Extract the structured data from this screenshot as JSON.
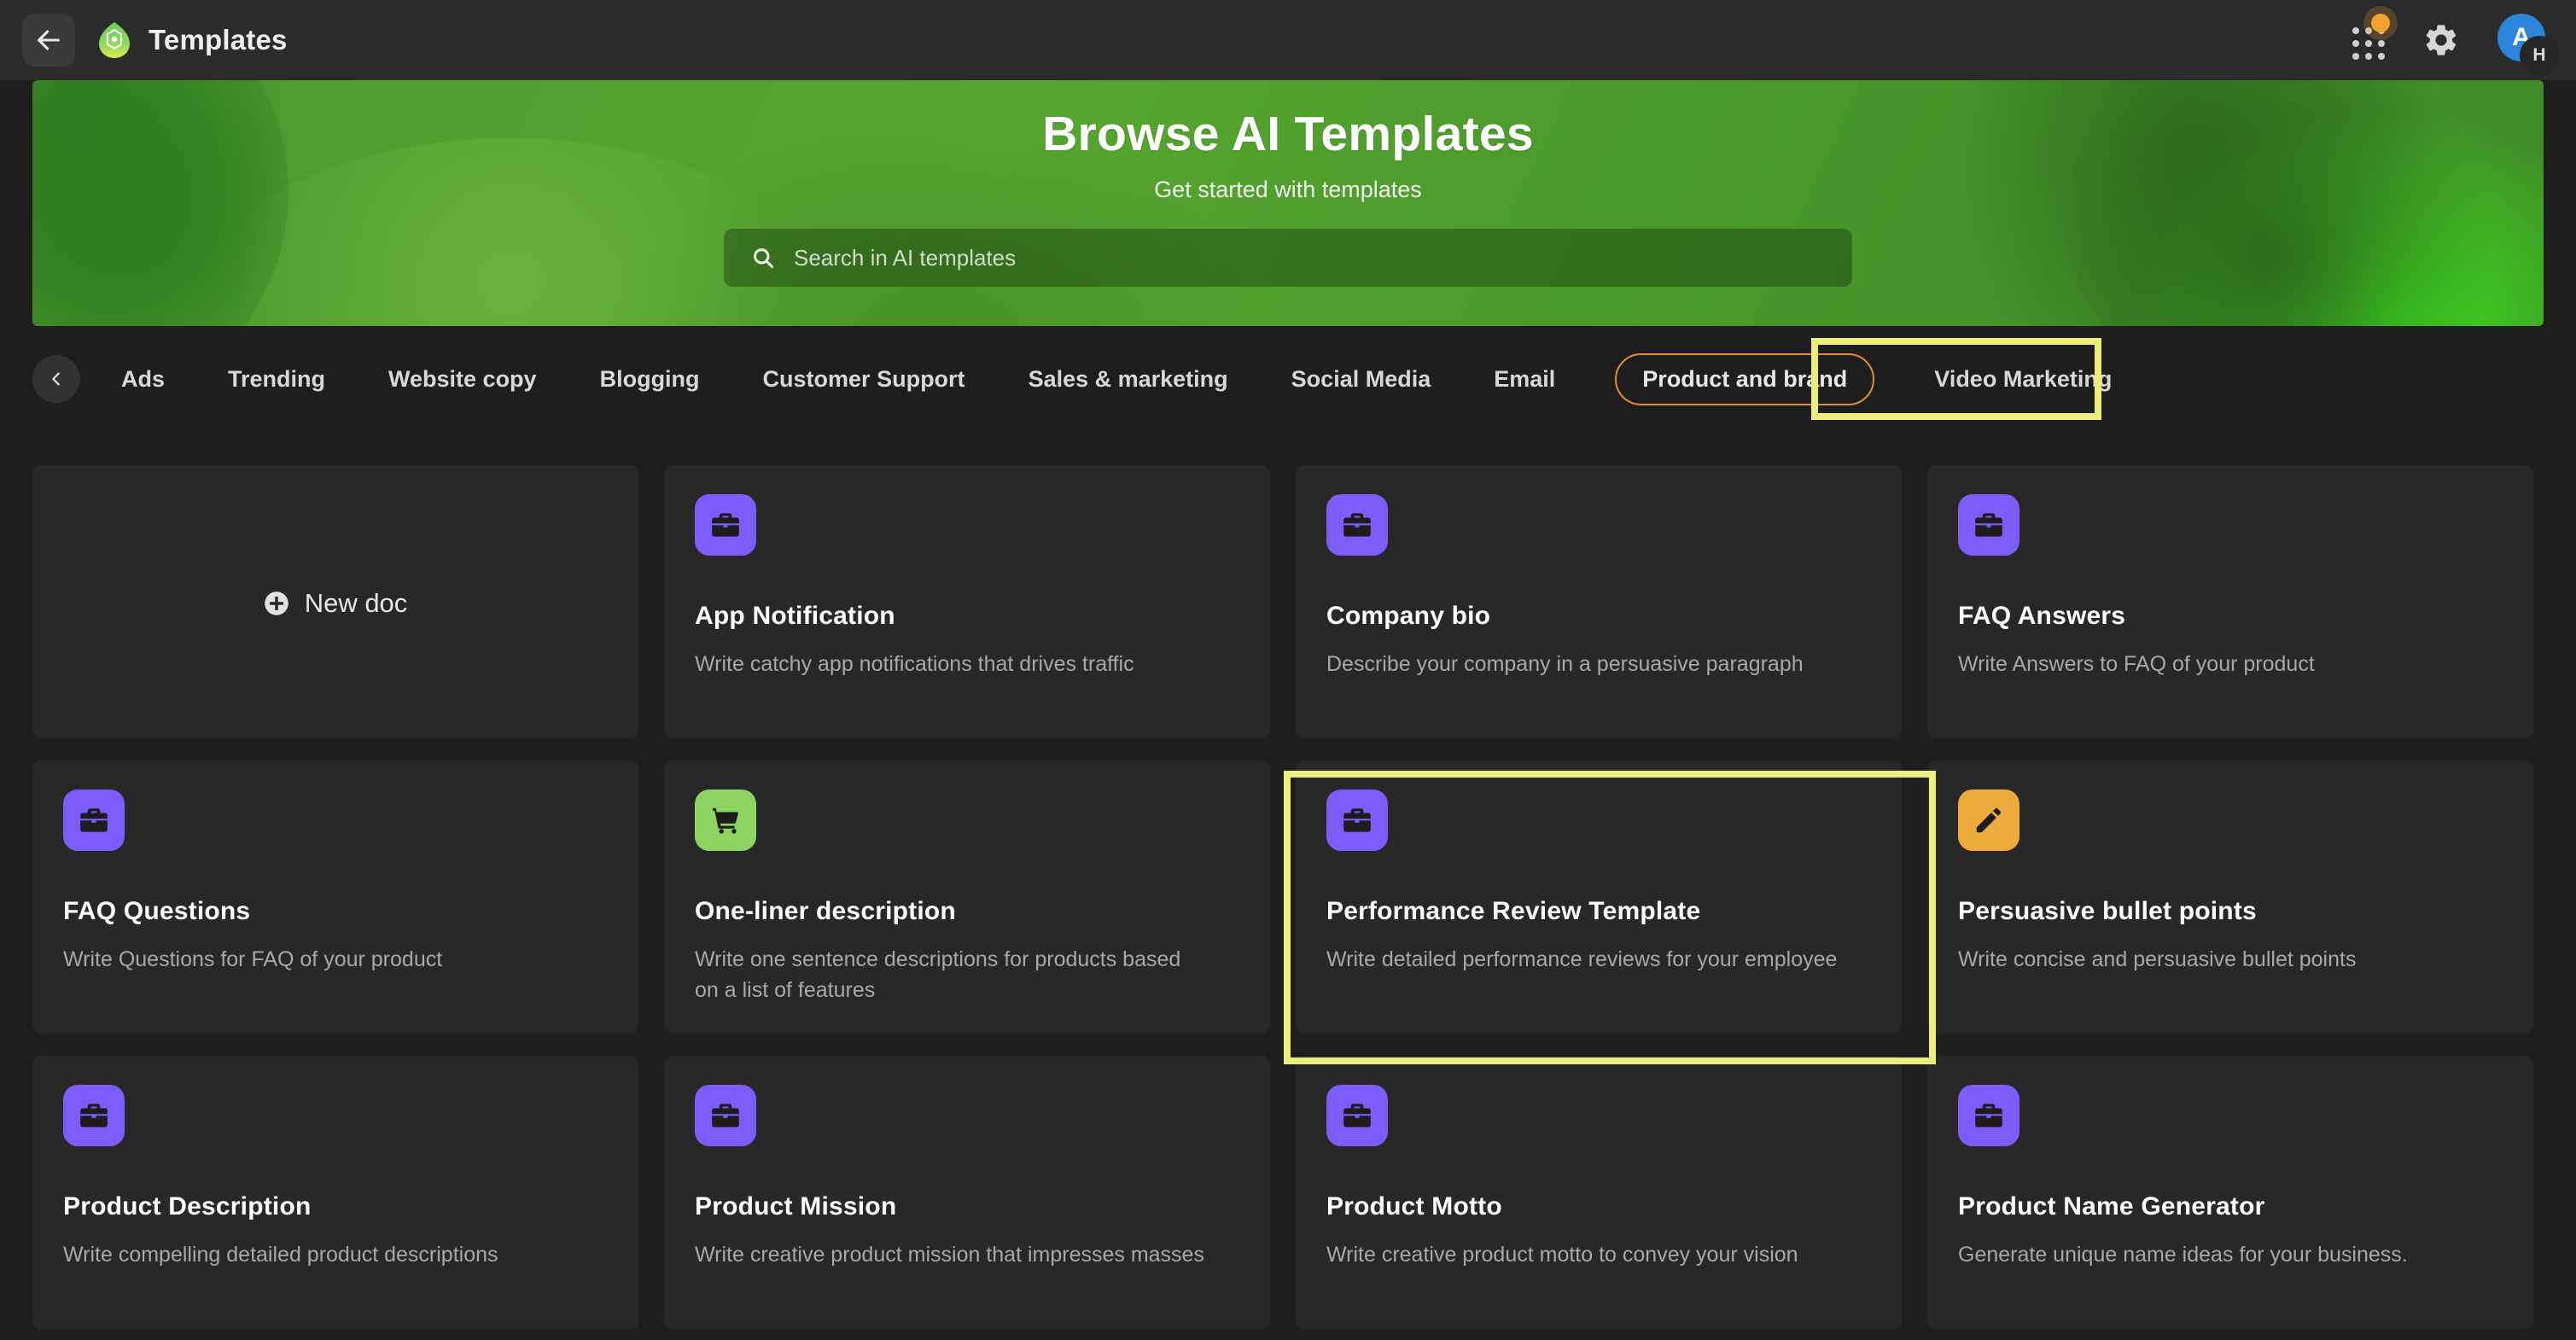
{
  "topbar": {
    "back_icon": "arrow-left-icon",
    "logo_icon": "app-logo-icon",
    "title": "Templates",
    "apps_icon": "apps-grid-icon",
    "settings_icon": "gear-icon",
    "avatar_initial": "A",
    "avatar_badge_initial": "H",
    "notification_color": "#f0a42b"
  },
  "hero": {
    "title": "Browse AI Templates",
    "subtitle": "Get started with templates",
    "search_icon": "search-icon",
    "search_placeholder": "Search in AI templates",
    "search_value": "",
    "bg_color": "#4e9b2e",
    "accent_color": "#3ee01f"
  },
  "categories": {
    "prev_icon": "chevron-left-icon",
    "selected": "Product and brand",
    "selected_color": "#e0912a",
    "items": [
      {
        "label": "Ads",
        "selected": false
      },
      {
        "label": "Trending",
        "selected": false
      },
      {
        "label": "Website copy",
        "selected": false
      },
      {
        "label": "Blogging",
        "selected": false
      },
      {
        "label": "Customer Support",
        "selected": false
      },
      {
        "label": "Sales & marketing",
        "selected": false
      },
      {
        "label": "Social Media",
        "selected": false
      },
      {
        "label": "Email",
        "selected": false
      },
      {
        "label": "Product and brand",
        "selected": true
      },
      {
        "label": "Video Marketing",
        "selected": false
      }
    ]
  },
  "new_doc": {
    "label": "New doc",
    "icon": "plus-circle-icon"
  },
  "cards": [
    {
      "title": "App Notification",
      "desc": "Write catchy app notifications that drives traffic",
      "icon": "briefcase-icon",
      "icon_bg": "#7c5cfa",
      "highlighted": false
    },
    {
      "title": "Company bio",
      "desc": "Describe your company in a persuasive paragraph",
      "icon": "briefcase-icon",
      "icon_bg": "#7c5cfa",
      "highlighted": false
    },
    {
      "title": "FAQ Answers",
      "desc": "Write Answers to FAQ of your product",
      "icon": "briefcase-icon",
      "icon_bg": "#7c5cfa",
      "highlighted": false
    },
    {
      "title": "FAQ Questions",
      "desc": "Write Questions for FAQ of your product",
      "icon": "briefcase-icon",
      "icon_bg": "#7c5cfa",
      "highlighted": false
    },
    {
      "title": "One-liner description",
      "desc": "Write one sentence descriptions for products based on a list of features",
      "icon": "shopping-cart-icon",
      "icon_bg": "#8ed463",
      "highlighted": false
    },
    {
      "title": "Performance Review Template",
      "desc": "Write detailed performance reviews for your employee",
      "icon": "briefcase-icon",
      "icon_bg": "#7c5cfa",
      "highlighted": true
    },
    {
      "title": "Persuasive bullet points",
      "desc": "Write concise and persuasive bullet points",
      "icon": "pencil-icon",
      "icon_bg": "#eeab3c",
      "highlighted": false
    },
    {
      "title": "Product Description",
      "desc": "Write compelling detailed product descriptions",
      "icon": "briefcase-icon",
      "icon_bg": "#7c5cfa",
      "highlighted": false
    },
    {
      "title": "Product Mission",
      "desc": "Write creative product mission that impresses masses",
      "icon": "briefcase-icon",
      "icon_bg": "#7c5cfa",
      "highlighted": false
    },
    {
      "title": "Product Motto",
      "desc": "Write creative product motto to convey your vision",
      "icon": "briefcase-icon",
      "icon_bg": "#7c5cfa",
      "highlighted": false
    },
    {
      "title": "Product Name Generator",
      "desc": "Generate unique name ideas for your business.",
      "icon": "briefcase-icon",
      "icon_bg": "#7c5cfa",
      "highlighted": false
    }
  ],
  "annotations": {
    "highlight_color": "#ecef79",
    "targets": [
      "Product and brand",
      "Performance Review Template"
    ]
  }
}
